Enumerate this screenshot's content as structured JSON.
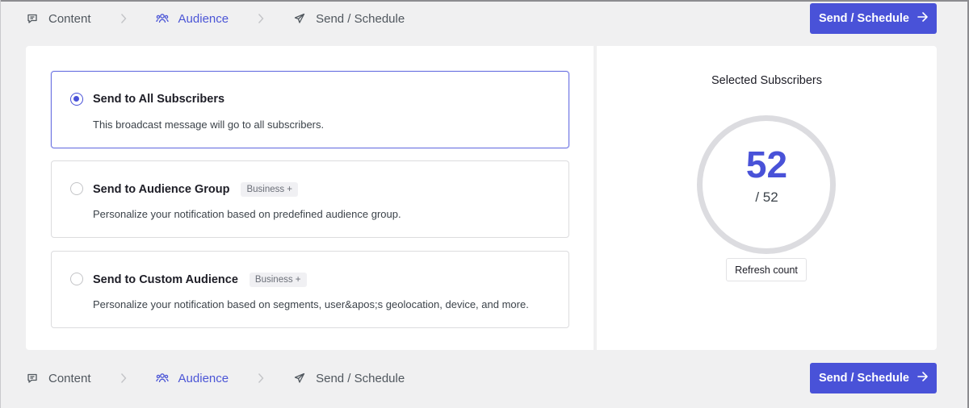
{
  "steps": [
    {
      "label": "Content",
      "icon": "message-square-icon",
      "active": false
    },
    {
      "label": "Audience",
      "icon": "users-icon",
      "active": true
    },
    {
      "label": "Send / Schedule",
      "icon": "paper-plane-icon",
      "active": false
    }
  ],
  "top_bar": {
    "step_content": "Content",
    "step_audience": "Audience",
    "step_send": "Send / Schedule",
    "send_button_label": "Send / Schedule"
  },
  "bottom_bar": {
    "step_content": "Content",
    "step_audience": "Audience",
    "step_send": "Send / Schedule",
    "send_button_label": "Send / Schedule"
  },
  "audience_options": [
    {
      "title": "Send to All Subscribers",
      "description": "This broadcast message will go to all subscribers.",
      "badge": "",
      "selected": true
    },
    {
      "title": "Send to Audience Group",
      "description": "Personalize your notification based on predefined audience group.",
      "badge": "Business +",
      "selected": false
    },
    {
      "title": "Send to Custom Audience",
      "description": "Personalize your notification based on segments, user&apos;s geolocation, device, and more.",
      "badge": "Business +",
      "selected": false
    }
  ],
  "subscribers": {
    "title": "Selected Subscribers",
    "count": "52",
    "total": "/ 52",
    "refresh_label": "Refresh count"
  },
  "colors": {
    "accent": "#4952d8",
    "active_step": "#4b55d6",
    "ring": "#dcdce0",
    "background": "#f0f0f1"
  }
}
